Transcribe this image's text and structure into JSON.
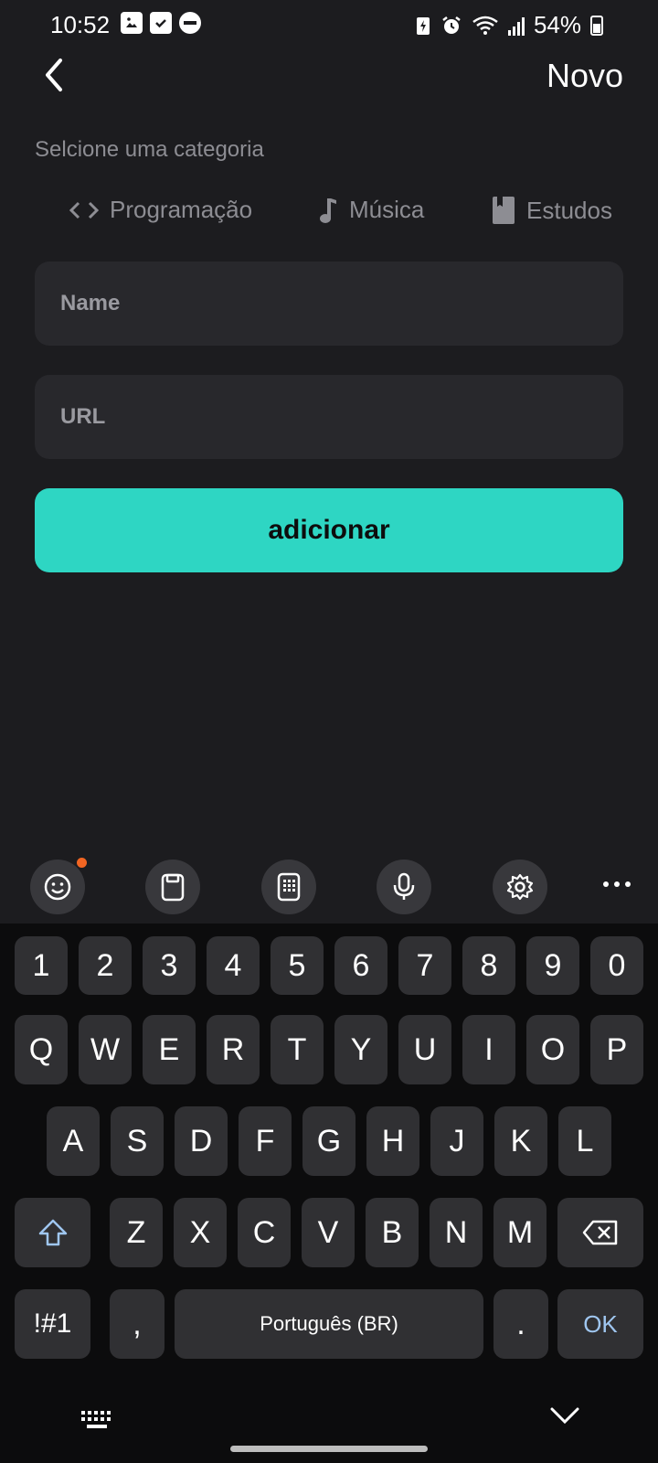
{
  "status": {
    "time": "10:52",
    "battery": "54%"
  },
  "header": {
    "title": "Novo"
  },
  "form": {
    "category_label": "Selcione uma categoria",
    "categories": [
      {
        "label": "Programação",
        "icon": "code-icon"
      },
      {
        "label": "Música",
        "icon": "music-note-icon"
      },
      {
        "label": "Estudos",
        "icon": "book-icon"
      }
    ],
    "name_placeholder": "Name",
    "url_placeholder": "URL",
    "submit_label": "adicionar"
  },
  "keyboard": {
    "toolbar": [
      "emoji-icon",
      "clipboard-icon",
      "keypad-icon",
      "microphone-icon",
      "settings-icon",
      "more-icon"
    ],
    "row_numbers": [
      "1",
      "2",
      "3",
      "4",
      "5",
      "6",
      "7",
      "8",
      "9",
      "0"
    ],
    "row_q": [
      "Q",
      "W",
      "E",
      "R",
      "T",
      "Y",
      "U",
      "I",
      "O",
      "P"
    ],
    "row_a": [
      "A",
      "S",
      "D",
      "F",
      "G",
      "H",
      "J",
      "K",
      "L"
    ],
    "row_z": [
      "Z",
      "X",
      "C",
      "V",
      "B",
      "N",
      "M"
    ],
    "symbols_label": "!#1",
    "comma_label": ",",
    "space_label": "Português (BR)",
    "period_label": ".",
    "ok_label": "OK"
  },
  "colors": {
    "accent": "#2ed6c3",
    "background": "#1c1c1f",
    "field": "#28282c"
  }
}
